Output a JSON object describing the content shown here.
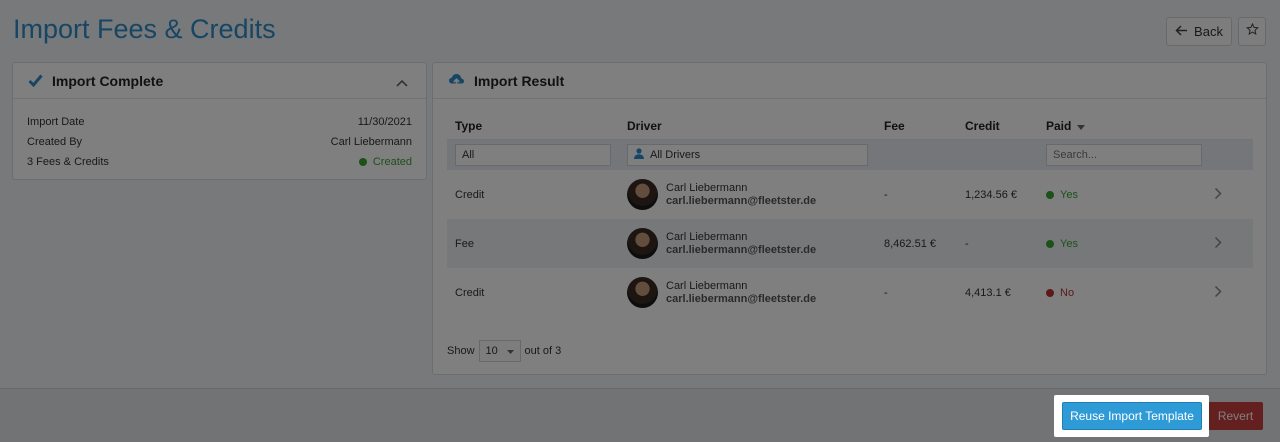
{
  "header": {
    "title": "Import Fees & Credits",
    "back_label": "Back"
  },
  "summary": {
    "title": "Import Complete",
    "rows": [
      {
        "label": "Import Date",
        "value": "11/30/2021"
      },
      {
        "label": "Created By",
        "value": "Carl Liebermann"
      },
      {
        "label": "3 Fees & Credits",
        "value": "Created"
      }
    ]
  },
  "result": {
    "title": "Import Result",
    "columns": {
      "type": "Type",
      "driver": "Driver",
      "fee": "Fee",
      "credit": "Credit",
      "paid": "Paid"
    },
    "filters": {
      "type": "All",
      "driver": "All Drivers",
      "paid_placeholder": "Search..."
    },
    "rows": [
      {
        "type": "Credit",
        "name": "Carl Liebermann",
        "email": "carl.liebermann@fleetster.de",
        "fee": "-",
        "credit": "1,234.56 €",
        "paid": "Yes"
      },
      {
        "type": "Fee",
        "name": "Carl Liebermann",
        "email": "carl.liebermann@fleetster.de",
        "fee": "8,462.51 €",
        "credit": "-",
        "paid": "Yes"
      },
      {
        "type": "Credit",
        "name": "Carl Liebermann",
        "email": "carl.liebermann@fleetster.de",
        "fee": "-",
        "credit": "4,413.1 €",
        "paid": "No"
      }
    ],
    "pagination": {
      "show_label": "Show",
      "page_size": "10",
      "out_of": "out of 3"
    }
  },
  "footer": {
    "reuse_label": "Reuse Import Template",
    "revert_label": "Revert"
  },
  "colors": {
    "accent": "#2f8dc8",
    "success": "#3aa335",
    "danger": "#b83333"
  }
}
